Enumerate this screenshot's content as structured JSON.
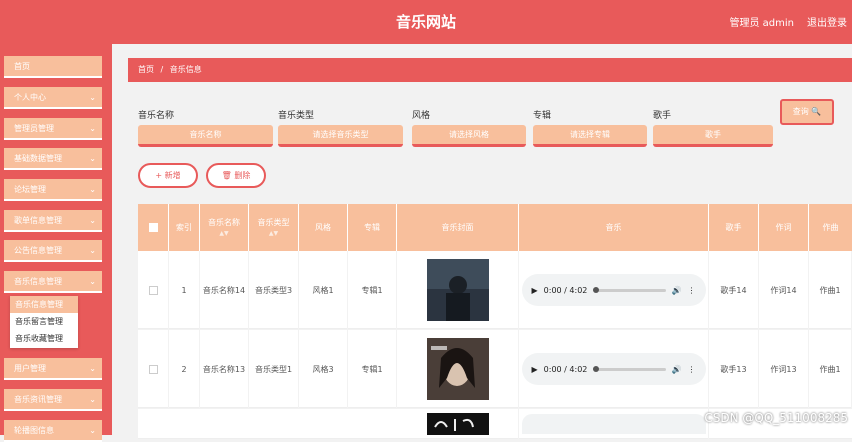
{
  "header": {
    "title": "音乐网站",
    "user": "管理员 admin",
    "logout": "退出登录"
  },
  "sidebar": {
    "items": [
      {
        "label": "首页",
        "chevron": false
      },
      {
        "label": "个人中心",
        "chevron": true
      },
      {
        "label": "管理员管理",
        "chevron": true
      },
      {
        "label": "基础数据管理",
        "chevron": true
      },
      {
        "label": "论坛管理",
        "chevron": true
      },
      {
        "label": "歌单信息管理",
        "chevron": true
      },
      {
        "label": "公告信息管理",
        "chevron": true
      },
      {
        "label": "音乐信息管理",
        "chevron": true
      },
      {
        "label": "用户管理",
        "chevron": true
      },
      {
        "label": "音乐资讯管理",
        "chevron": true
      },
      {
        "label": "轮播图信息",
        "chevron": true
      }
    ],
    "submenu": [
      "音乐信息管理",
      "音乐留言管理",
      "音乐收藏管理"
    ]
  },
  "breadcrumb": {
    "home": "首页",
    "sep": "/",
    "current": "音乐信息"
  },
  "search": {
    "fields": [
      {
        "label": "音乐名称",
        "placeholder": "音乐名称"
      },
      {
        "label": "音乐类型",
        "placeholder": "请选择音乐类型"
      },
      {
        "label": "风格",
        "placeholder": "请选择风格"
      },
      {
        "label": "专辑",
        "placeholder": "请选择专辑"
      },
      {
        "label": "歌手",
        "placeholder": "歌手"
      }
    ],
    "query_label": "查询 🔍"
  },
  "actions": {
    "add": "+ 新增",
    "delete": "🗑 删除"
  },
  "table": {
    "columns": [
      "",
      "索引",
      "音乐名称",
      "音乐类型",
      "风格",
      "专辑",
      "音乐封面",
      "音乐",
      "歌手",
      "作词",
      "作曲"
    ],
    "rows": [
      {
        "index": "1",
        "name": "音乐名称14",
        "type": "音乐类型3",
        "style": "风格1",
        "album": "专辑1",
        "time": "0:00 / 4:02",
        "singer": "歌手14",
        "lyric": "作词14",
        "composer": "作曲1"
      },
      {
        "index": "2",
        "name": "音乐名称13",
        "type": "音乐类型1",
        "style": "风格3",
        "album": "专辑1",
        "time": "0:00 / 4:02",
        "singer": "歌手13",
        "lyric": "作词13",
        "composer": "作曲1"
      }
    ]
  },
  "watermark": "CSDN @QQ_511008285"
}
